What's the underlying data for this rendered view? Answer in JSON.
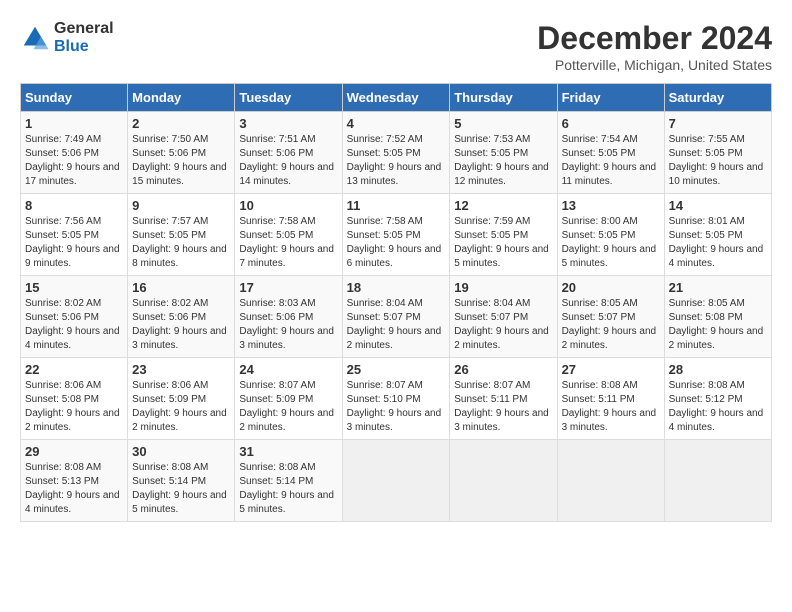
{
  "header": {
    "logo": {
      "general": "General",
      "blue": "Blue"
    },
    "title": "December 2024",
    "subtitle": "Potterville, Michigan, United States"
  },
  "weekdays": [
    "Sunday",
    "Monday",
    "Tuesday",
    "Wednesday",
    "Thursday",
    "Friday",
    "Saturday"
  ],
  "weeks": [
    [
      {
        "day": "1",
        "info": "Sunrise: 7:49 AM\nSunset: 5:06 PM\nDaylight: 9 hours and 17 minutes."
      },
      {
        "day": "2",
        "info": "Sunrise: 7:50 AM\nSunset: 5:06 PM\nDaylight: 9 hours and 15 minutes."
      },
      {
        "day": "3",
        "info": "Sunrise: 7:51 AM\nSunset: 5:06 PM\nDaylight: 9 hours and 14 minutes."
      },
      {
        "day": "4",
        "info": "Sunrise: 7:52 AM\nSunset: 5:05 PM\nDaylight: 9 hours and 13 minutes."
      },
      {
        "day": "5",
        "info": "Sunrise: 7:53 AM\nSunset: 5:05 PM\nDaylight: 9 hours and 12 minutes."
      },
      {
        "day": "6",
        "info": "Sunrise: 7:54 AM\nSunset: 5:05 PM\nDaylight: 9 hours and 11 minutes."
      },
      {
        "day": "7",
        "info": "Sunrise: 7:55 AM\nSunset: 5:05 PM\nDaylight: 9 hours and 10 minutes."
      }
    ],
    [
      {
        "day": "8",
        "info": "Sunrise: 7:56 AM\nSunset: 5:05 PM\nDaylight: 9 hours and 9 minutes."
      },
      {
        "day": "9",
        "info": "Sunrise: 7:57 AM\nSunset: 5:05 PM\nDaylight: 9 hours and 8 minutes."
      },
      {
        "day": "10",
        "info": "Sunrise: 7:58 AM\nSunset: 5:05 PM\nDaylight: 9 hours and 7 minutes."
      },
      {
        "day": "11",
        "info": "Sunrise: 7:58 AM\nSunset: 5:05 PM\nDaylight: 9 hours and 6 minutes."
      },
      {
        "day": "12",
        "info": "Sunrise: 7:59 AM\nSunset: 5:05 PM\nDaylight: 9 hours and 5 minutes."
      },
      {
        "day": "13",
        "info": "Sunrise: 8:00 AM\nSunset: 5:05 PM\nDaylight: 9 hours and 5 minutes."
      },
      {
        "day": "14",
        "info": "Sunrise: 8:01 AM\nSunset: 5:05 PM\nDaylight: 9 hours and 4 minutes."
      }
    ],
    [
      {
        "day": "15",
        "info": "Sunrise: 8:02 AM\nSunset: 5:06 PM\nDaylight: 9 hours and 4 minutes."
      },
      {
        "day": "16",
        "info": "Sunrise: 8:02 AM\nSunset: 5:06 PM\nDaylight: 9 hours and 3 minutes."
      },
      {
        "day": "17",
        "info": "Sunrise: 8:03 AM\nSunset: 5:06 PM\nDaylight: 9 hours and 3 minutes."
      },
      {
        "day": "18",
        "info": "Sunrise: 8:04 AM\nSunset: 5:07 PM\nDaylight: 9 hours and 2 minutes."
      },
      {
        "day": "19",
        "info": "Sunrise: 8:04 AM\nSunset: 5:07 PM\nDaylight: 9 hours and 2 minutes."
      },
      {
        "day": "20",
        "info": "Sunrise: 8:05 AM\nSunset: 5:07 PM\nDaylight: 9 hours and 2 minutes."
      },
      {
        "day": "21",
        "info": "Sunrise: 8:05 AM\nSunset: 5:08 PM\nDaylight: 9 hours and 2 minutes."
      }
    ],
    [
      {
        "day": "22",
        "info": "Sunrise: 8:06 AM\nSunset: 5:08 PM\nDaylight: 9 hours and 2 minutes."
      },
      {
        "day": "23",
        "info": "Sunrise: 8:06 AM\nSunset: 5:09 PM\nDaylight: 9 hours and 2 minutes."
      },
      {
        "day": "24",
        "info": "Sunrise: 8:07 AM\nSunset: 5:09 PM\nDaylight: 9 hours and 2 minutes."
      },
      {
        "day": "25",
        "info": "Sunrise: 8:07 AM\nSunset: 5:10 PM\nDaylight: 9 hours and 3 minutes."
      },
      {
        "day": "26",
        "info": "Sunrise: 8:07 AM\nSunset: 5:11 PM\nDaylight: 9 hours and 3 minutes."
      },
      {
        "day": "27",
        "info": "Sunrise: 8:08 AM\nSunset: 5:11 PM\nDaylight: 9 hours and 3 minutes."
      },
      {
        "day": "28",
        "info": "Sunrise: 8:08 AM\nSunset: 5:12 PM\nDaylight: 9 hours and 4 minutes."
      }
    ],
    [
      {
        "day": "29",
        "info": "Sunrise: 8:08 AM\nSunset: 5:13 PM\nDaylight: 9 hours and 4 minutes."
      },
      {
        "day": "30",
        "info": "Sunrise: 8:08 AM\nSunset: 5:14 PM\nDaylight: 9 hours and 5 minutes."
      },
      {
        "day": "31",
        "info": "Sunrise: 8:08 AM\nSunset: 5:14 PM\nDaylight: 9 hours and 5 minutes."
      },
      null,
      null,
      null,
      null
    ]
  ]
}
